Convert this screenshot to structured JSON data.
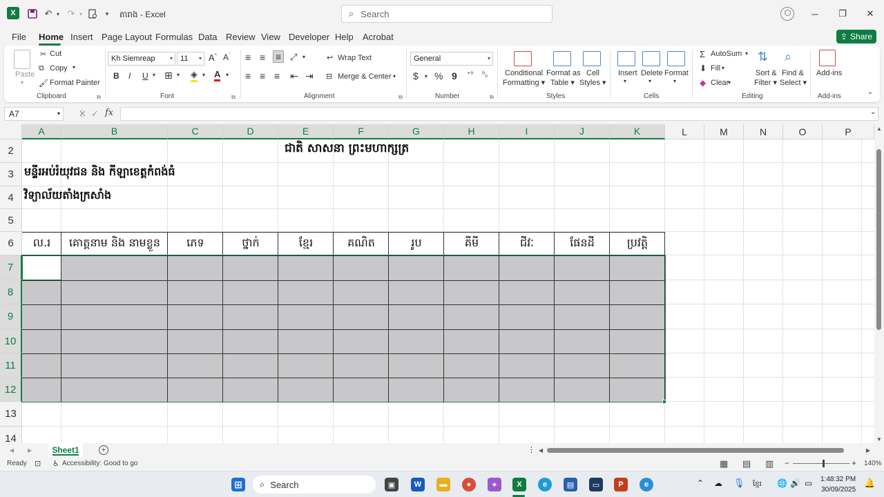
{
  "titlebar": {
    "app_icon": "X",
    "doc_title": "តារាង  -  Excel",
    "search_placeholder": "Search"
  },
  "menu": {
    "tabs": [
      "File",
      "Home",
      "Insert",
      "Page Layout",
      "Formulas",
      "Data",
      "Review",
      "View",
      "Developer",
      "Help",
      "Acrobat"
    ],
    "active": "Home",
    "share_label": "Share"
  },
  "ribbon": {
    "clipboard": {
      "paste": "Paste",
      "cut": "Cut",
      "copy": "Copy",
      "format_painter": "Format Painter",
      "label": "Clipboard"
    },
    "font": {
      "name": "Kh Siemreap",
      "size": "11",
      "bold": "B",
      "italic": "I",
      "underline": "U",
      "label": "Font"
    },
    "alignment": {
      "wrap_text": "Wrap Text",
      "merge_center": "Merge & Center",
      "label": "Alignment"
    },
    "number": {
      "format": "General",
      "label": "Number"
    },
    "styles": {
      "conditional": "Conditional",
      "formatting": "Formatting",
      "format_as": "Format as",
      "table": "Table",
      "cell": "Cell",
      "styles_btn": "Styles",
      "label": "Styles"
    },
    "cells": {
      "insert": "Insert",
      "delete": "Delete",
      "format": "Format",
      "label": "Cells"
    },
    "editing": {
      "autosum": "AutoSum",
      "fill": "Fill",
      "clear": "Clear",
      "sort": "Sort &",
      "filter": "Filter",
      "find": "Find &",
      "select": "Select",
      "label": "Editing"
    },
    "addins": {
      "addins": "Add-ins",
      "label": "Add-ins"
    }
  },
  "formula_bar": {
    "name_box": "A7",
    "fx": "fx",
    "value": ""
  },
  "sheet": {
    "columns": [
      "A",
      "B",
      "C",
      "D",
      "E",
      "F",
      "G",
      "H",
      "I",
      "J",
      "K",
      "L",
      "M",
      "N",
      "O",
      "P"
    ],
    "rows": [
      "2",
      "3",
      "4",
      "5",
      "6",
      "7",
      "8",
      "9",
      "10",
      "11",
      "12",
      "13",
      "14"
    ],
    "title_line": "ជាតិ  សាសនា  ព្រះមហាក្សត្រ",
    "line_ministry": "មន្ទីរអប់រំយុវជន និង កីឡាខេត្តកំពង់ធំ",
    "line_school": "វិទ្យាល័យតាំងក្រសាំង",
    "table_headers": [
      "ល.រ",
      "គោត្តនាម និង នាមខ្លួន",
      "ភេទ",
      "ថ្នាក់",
      "ខ្មែរ",
      "គណិត",
      "រូប",
      "គីមី",
      "ជីវៈ",
      "ផែនដី",
      "ប្រវត្តិ"
    ]
  },
  "sheet_tabs": {
    "active": "Sheet1"
  },
  "status": {
    "ready": "Ready",
    "accessibility": "Accessibility: Good to go",
    "zoom": "140%"
  },
  "taskbar": {
    "search": "Search",
    "time": "1:48:32 PM",
    "date": "30/09/2025",
    "lang": "ខ្មែរ"
  }
}
